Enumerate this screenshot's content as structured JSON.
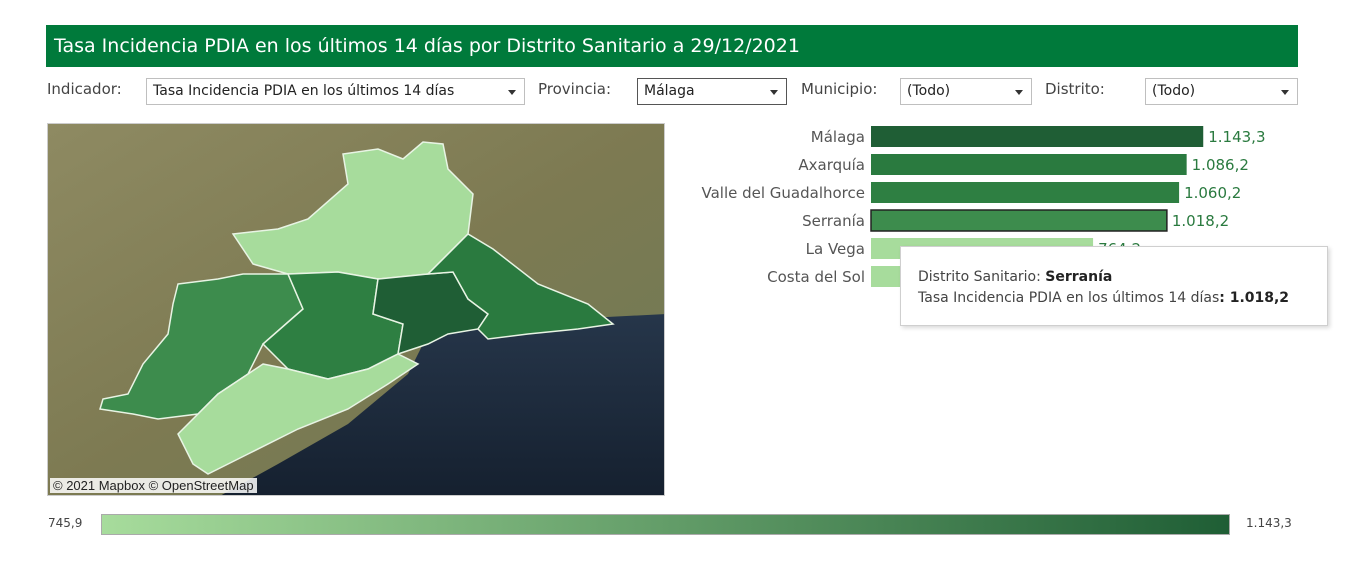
{
  "header": {
    "title": "Tasa Incidencia PDIA en los últimos 14 días por Distrito Sanitario a 29/12/2021"
  },
  "filters": {
    "indicador": {
      "label": "Indicador:",
      "value": "Tasa Incidencia PDIA en los últimos 14 días"
    },
    "provincia": {
      "label": "Provincia:",
      "value": "Málaga"
    },
    "municipio": {
      "label": "Municipio:",
      "value": "(Todo)"
    },
    "distrito": {
      "label": "Distrito:",
      "value": "(Todo)"
    }
  },
  "map": {
    "attribution": "© 2021 Mapbox  © OpenStreetMap",
    "colors": {
      "land": "#8a8660",
      "sea": "#1b2a3d",
      "border": "#e8f4e4"
    }
  },
  "chart_data": {
    "type": "bar",
    "orientation": "horizontal",
    "categories": [
      "Málaga",
      "Axarquía",
      "Valle del Guadalhorce",
      "Serranía",
      "La Vega",
      "Costa del Sol"
    ],
    "values": [
      1143.3,
      1086.2,
      1060.2,
      1018.2,
      764.2,
      745.9
    ],
    "value_labels": [
      "1.143,3",
      "1.086,2",
      "1.060,2",
      "1.018,2",
      "764,2",
      ""
    ],
    "highlighted": "Serranía",
    "xlim": [
      0,
      1170
    ],
    "colors": [
      "#1f5e35",
      "#2a7a3f",
      "#2e7f42",
      "#3d8c4d",
      "#a7dc9c",
      "#a7dc9c"
    ],
    "label_color": "#2a7a3f"
  },
  "tooltip": {
    "line1_label": "Distrito Sanitario: ",
    "line1_value": "Serranía",
    "line2_label": "Tasa Incidencia PDIA en los últimos 14 días",
    "line2_value": ": 1.018,2"
  },
  "legend": {
    "min": "745,9",
    "max": "1.143,3",
    "min_color": "#a7dc9c",
    "max_color": "#1f5e35"
  }
}
